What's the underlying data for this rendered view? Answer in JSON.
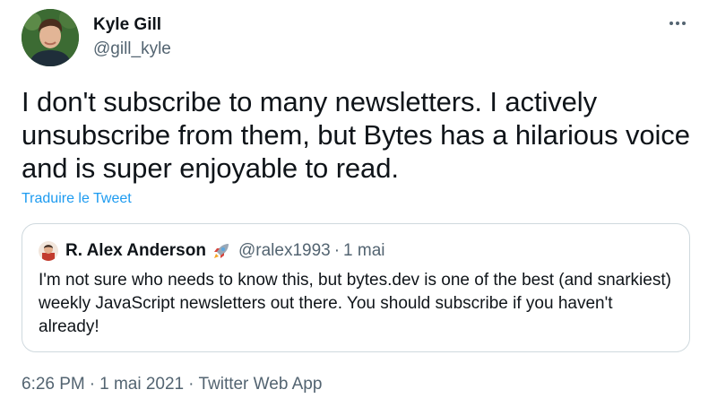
{
  "author": {
    "name": "Kyle Gill",
    "handle": "@gill_kyle"
  },
  "more_icon": "more-horizontal-icon",
  "tweet": {
    "text": "I don't subscribe to many newsletters. I actively unsubscribe from them, but Bytes has a hilarious voice and is super enjoyable to read.",
    "translate_label": "Traduire le Tweet"
  },
  "quote": {
    "name": "R. Alex Anderson",
    "emoji": "rocket-emoji",
    "handle": "@ralex1993",
    "separator": "·",
    "date": "1 mai",
    "text": "I'm not sure who needs to know this, but bytes.dev is one of the best (and snarkiest) weekly JavaScript newsletters out there. You should subscribe if you haven't already!"
  },
  "meta": {
    "time": "6:26 PM",
    "separator": "·",
    "date": "1 mai 2021",
    "source": "Twitter Web App"
  },
  "colors": {
    "link": "#1d9bf0",
    "secondary_text": "#536471",
    "border": "#cfd9de"
  }
}
